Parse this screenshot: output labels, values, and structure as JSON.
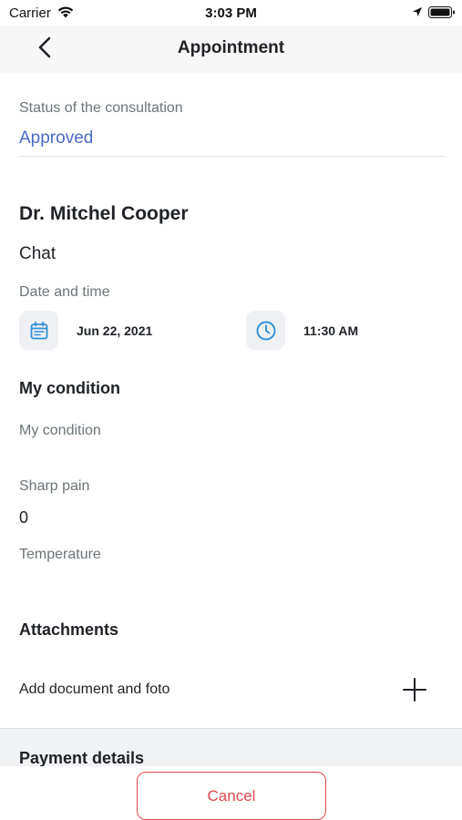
{
  "status_bar": {
    "carrier": "Carrier",
    "time": "3:03 PM",
    "icons": [
      "wifi-icon",
      "location-arrow-icon",
      "battery-icon"
    ]
  },
  "nav": {
    "title": "Appointment",
    "back_icon": "chevron-left-icon"
  },
  "consultation": {
    "status_label": "Status of the consultation",
    "status_value": "Approved",
    "status_color": "#4a6bc5"
  },
  "doctor": {
    "name": "Dr. Mitchel Cooper",
    "consult_type": "Chat"
  },
  "date_time": {
    "label": "Date and time",
    "date": "Jun 22, 2021",
    "time": "11:30 AM",
    "icon_color": "#2f8fd8",
    "icons": [
      "calendar-icon",
      "clock-icon"
    ]
  },
  "condition": {
    "title": "My condition",
    "placeholder": "My condition",
    "sharp_pain_label": "Sharp pain",
    "sharp_pain_value": "0",
    "temperature_label": "Temperature"
  },
  "attachments": {
    "title": "Attachments",
    "add_label": "Add document and foto",
    "add_icon": "plus-icon"
  },
  "payment": {
    "title": "Payment details"
  },
  "actions": {
    "cancel_label": "Cancel",
    "cancel_color": "#e0474c"
  }
}
